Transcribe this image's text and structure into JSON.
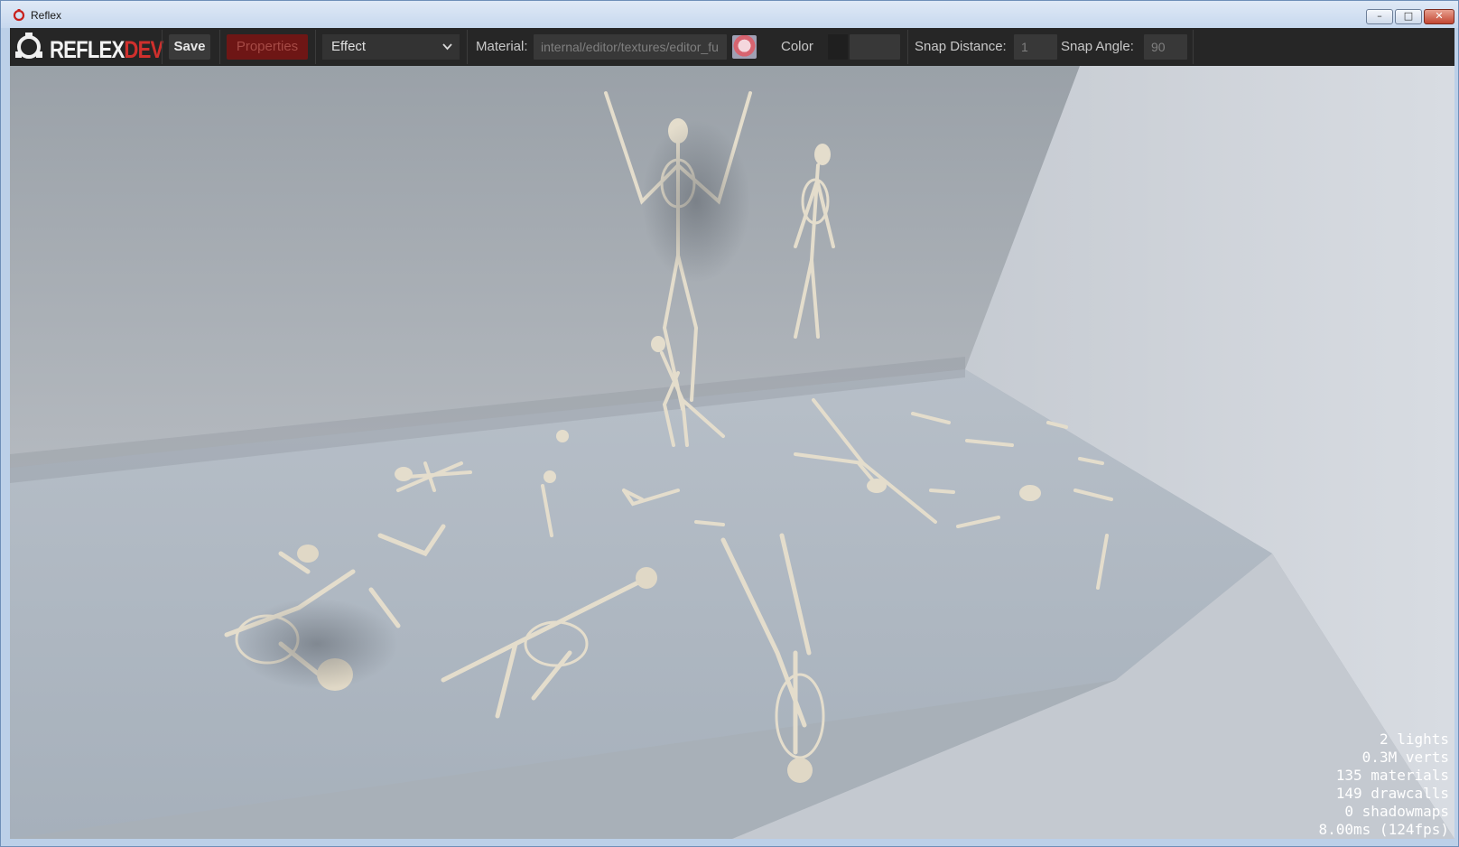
{
  "window": {
    "title": "Reflex",
    "controls": {
      "minimize": "–",
      "maximize": "□",
      "close": "✕"
    }
  },
  "toolbar": {
    "logo": {
      "brand": "REFLEX",
      "suffix": "DEV",
      "icon": "reflex-logo-icon"
    },
    "save_label": "Save",
    "properties_label": "Properties",
    "effect_select": {
      "value": "Effect"
    },
    "material": {
      "label": "Material:",
      "value": "internal/editor/textures/editor_fu",
      "thumbnail_icon": "material-preview-icon"
    },
    "color": {
      "label": "Color"
    },
    "snap_distance": {
      "label": "Snap Distance:",
      "value": "1"
    },
    "snap_angle": {
      "label": "Snap Angle:",
      "value": "90"
    }
  },
  "viewport": {
    "scene": "skeletons-room",
    "stats": [
      "2 lights",
      "0.3M verts",
      "135 materials",
      "149 drawcalls",
      "0 shadowmaps",
      "8.00ms (124fps)"
    ]
  },
  "colors": {
    "accent": "#d0302d",
    "toolbar_bg": "#262626",
    "properties_bg": "#6e1615"
  }
}
